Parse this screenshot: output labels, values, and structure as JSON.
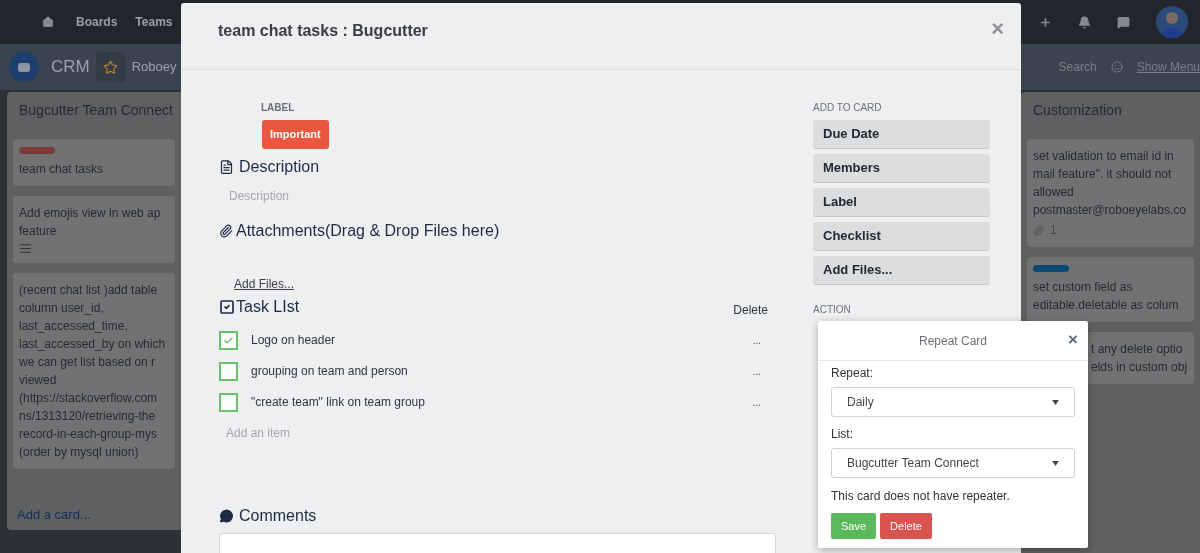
{
  "topbar": {
    "nav": [
      "Boards",
      "Teams"
    ]
  },
  "board_header": {
    "name": "CRM",
    "team": "Roboey",
    "search": "Search",
    "show_menu": "Show Menu"
  },
  "lists": [
    {
      "title": "Bugcutter Team Connect",
      "add_card": "Add a card...",
      "cards": [
        {
          "color": "#7a3b3b",
          "lines": [
            "team chat tasks"
          ],
          "has_description": false
        },
        {
          "lines": [
            "Add emojis view in web ap",
            "feature"
          ],
          "has_description": true
        },
        {
          "lines": [
            "(recent chat list )add table",
            "column user_id,",
            "last_accessed_time,",
            "last_accessed_by on which",
            "we can get list based on r",
            "viewed",
            "(https://stackoverflow.com",
            "ns/1313120/retrieving-the",
            "record-in-each-group-mys",
            "(order by mysql union)"
          ],
          "has_description": false
        }
      ]
    },
    {
      "title": "Customization",
      "cards": [
        {
          "lines": [
            "set validation to email id in",
            "mail feature\". it should not",
            "allowed",
            "postmaster@roboeyelabs.co"
          ],
          "attachments": "1",
          "has_description": false
        },
        {
          "color": "#0b4a73",
          "lines": [
            "set custom field as",
            "editable.deletable as colum"
          ],
          "has_description": false
        },
        {
          "kind": "covered",
          "lines": [
            "t any delete optio",
            "elds in custom obj"
          ],
          "has_description": false
        }
      ]
    }
  ],
  "modal": {
    "title": "team chat tasks : Bugcutter",
    "close": "×",
    "label_heading": "LABEL",
    "label": {
      "text": "Important",
      "color": "#e9573f"
    },
    "description_heading": "Description",
    "description_placeholder": "Description",
    "attachments_heading": "Attachments(Drag & Drop Files here)",
    "add_files": "Add Files...",
    "task_heading": "Task LIst",
    "task_delete": "Delete",
    "tasks": [
      {
        "text": "Logo on header",
        "checked": true,
        "menu": "..."
      },
      {
        "text": "grouping on team and person",
        "checked": false,
        "menu": "..."
      },
      {
        "text": "\"create team\" link on team group",
        "checked": false,
        "menu": "..."
      }
    ],
    "add_item_placeholder": "Add an item",
    "comments_heading": "Comments",
    "add_to_card_heading": "ADD TO CARD",
    "add_to_card": [
      "Due Date",
      "Members",
      "Label",
      "Checklist",
      "Add Files..."
    ],
    "action_heading": "ACTION"
  },
  "repeat_popup": {
    "title": "Repeat Card",
    "close": "×",
    "repeat_label": "Repeat:",
    "repeat_value": "Daily",
    "list_label": "List:",
    "list_value": "Bugcutter Team Connect",
    "message": "This card does not have repeater.",
    "buttons": [
      {
        "kind": "save",
        "text": "Save"
      },
      {
        "kind": "delete",
        "text": "Delete"
      }
    ]
  }
}
